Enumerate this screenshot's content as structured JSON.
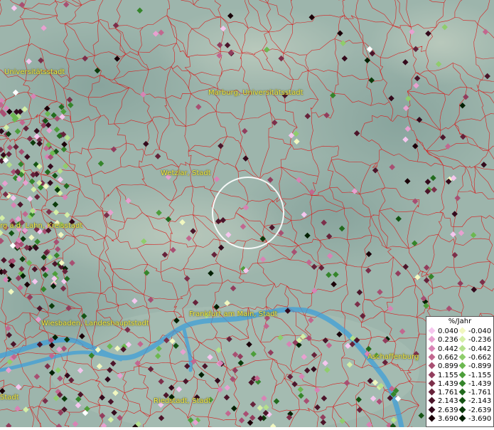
{
  "cities": [
    {
      "name": "Universitätsstadt"
    },
    {
      "name": "Marburg, Universitätsstadt"
    },
    {
      "name": "Wetzlar, Stadt"
    },
    {
      "name": "rg a.d. Lahn, Kreisstadt"
    },
    {
      "name": "Frankfurt am Main, Stadt"
    },
    {
      "name": "Wiesbaden, Landeshauptstadt"
    },
    {
      "name": "Aschaffenburg"
    },
    {
      "name": "Riedstadt, Stadt"
    },
    {
      "name": "Stadt"
    }
  ],
  "legend": {
    "title": "%/Jahr",
    "positive": [
      {
        "label": "0.040",
        "color": "#f5c6ee"
      },
      {
        "label": "0.236",
        "color": "#e8a0d0"
      },
      {
        "label": "0.442",
        "color": "#d883b5"
      },
      {
        "label": "0.662",
        "color": "#c2678f"
      },
      {
        "label": "0.899",
        "color": "#a84f72"
      },
      {
        "label": "1.155",
        "color": "#923d5d"
      },
      {
        "label": "1.439",
        "color": "#7c2f4a"
      },
      {
        "label": "1.761",
        "color": "#66223a"
      },
      {
        "label": "2.143",
        "color": "#4c152a"
      },
      {
        "label": "2.639",
        "color": "#340a1c"
      },
      {
        "label": "3.690",
        "color": "#1a0008"
      }
    ],
    "negative": [
      {
        "label": "-0.040",
        "color": "#f1f7c0"
      },
      {
        "label": "-0.236",
        "color": "#d4efa6"
      },
      {
        "label": "-0.442",
        "color": "#b4e08c"
      },
      {
        "label": "-0.662",
        "color": "#8fcd6c"
      },
      {
        "label": "-0.899",
        "color": "#6cb851"
      },
      {
        "label": "-1.155",
        "color": "#4d9e3b"
      },
      {
        "label": "-1.439",
        "color": "#35852b"
      },
      {
        "label": "-1.761",
        "color": "#226b1e"
      },
      {
        "label": "-2.143",
        "color": "#155414"
      },
      {
        "label": "-2.639",
        "color": "#0b3b0b"
      },
      {
        "label": "-3.690",
        "color": "#032003"
      }
    ]
  },
  "colors": {
    "boundary": "#d62020",
    "river": "#3f9fd8",
    "label": "#f0e94a",
    "selection_ring": "#ffffff"
  }
}
